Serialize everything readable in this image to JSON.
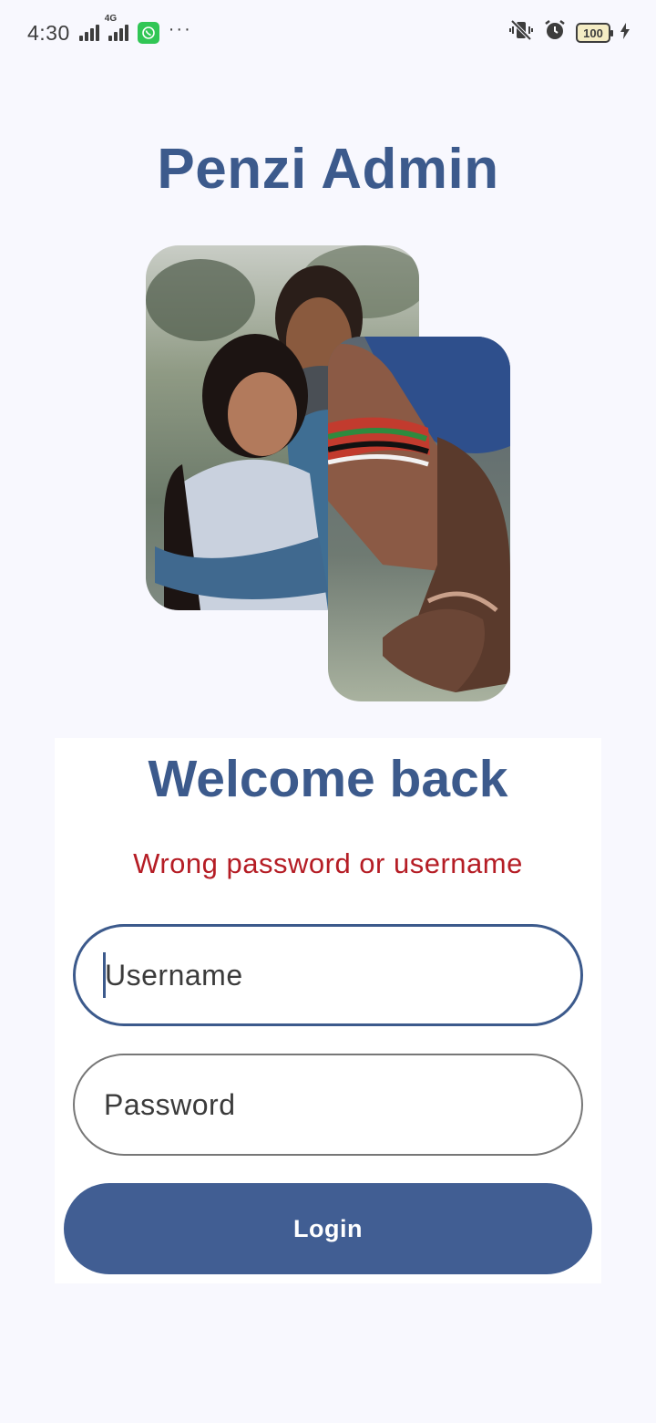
{
  "status_bar": {
    "time": "4:30",
    "network_tag": "4G",
    "overflow": "···",
    "battery_level": "100"
  },
  "app": {
    "title": "Penzi Admin"
  },
  "login_card": {
    "heading": "Welcome back",
    "error_message": "Wrong password or username",
    "username_placeholder": "Username",
    "password_placeholder": "Password",
    "login_label": "Login"
  },
  "colors": {
    "brand": "#3c5a8c",
    "button": "#415e93",
    "error": "#b51d25",
    "background": "#f8f8fe"
  },
  "icons": {
    "whatsapp": "whatsapp-icon",
    "vibrate_off": "vibrate-off-icon",
    "alarm": "alarm-icon",
    "charging": "charging-bolt-icon"
  }
}
